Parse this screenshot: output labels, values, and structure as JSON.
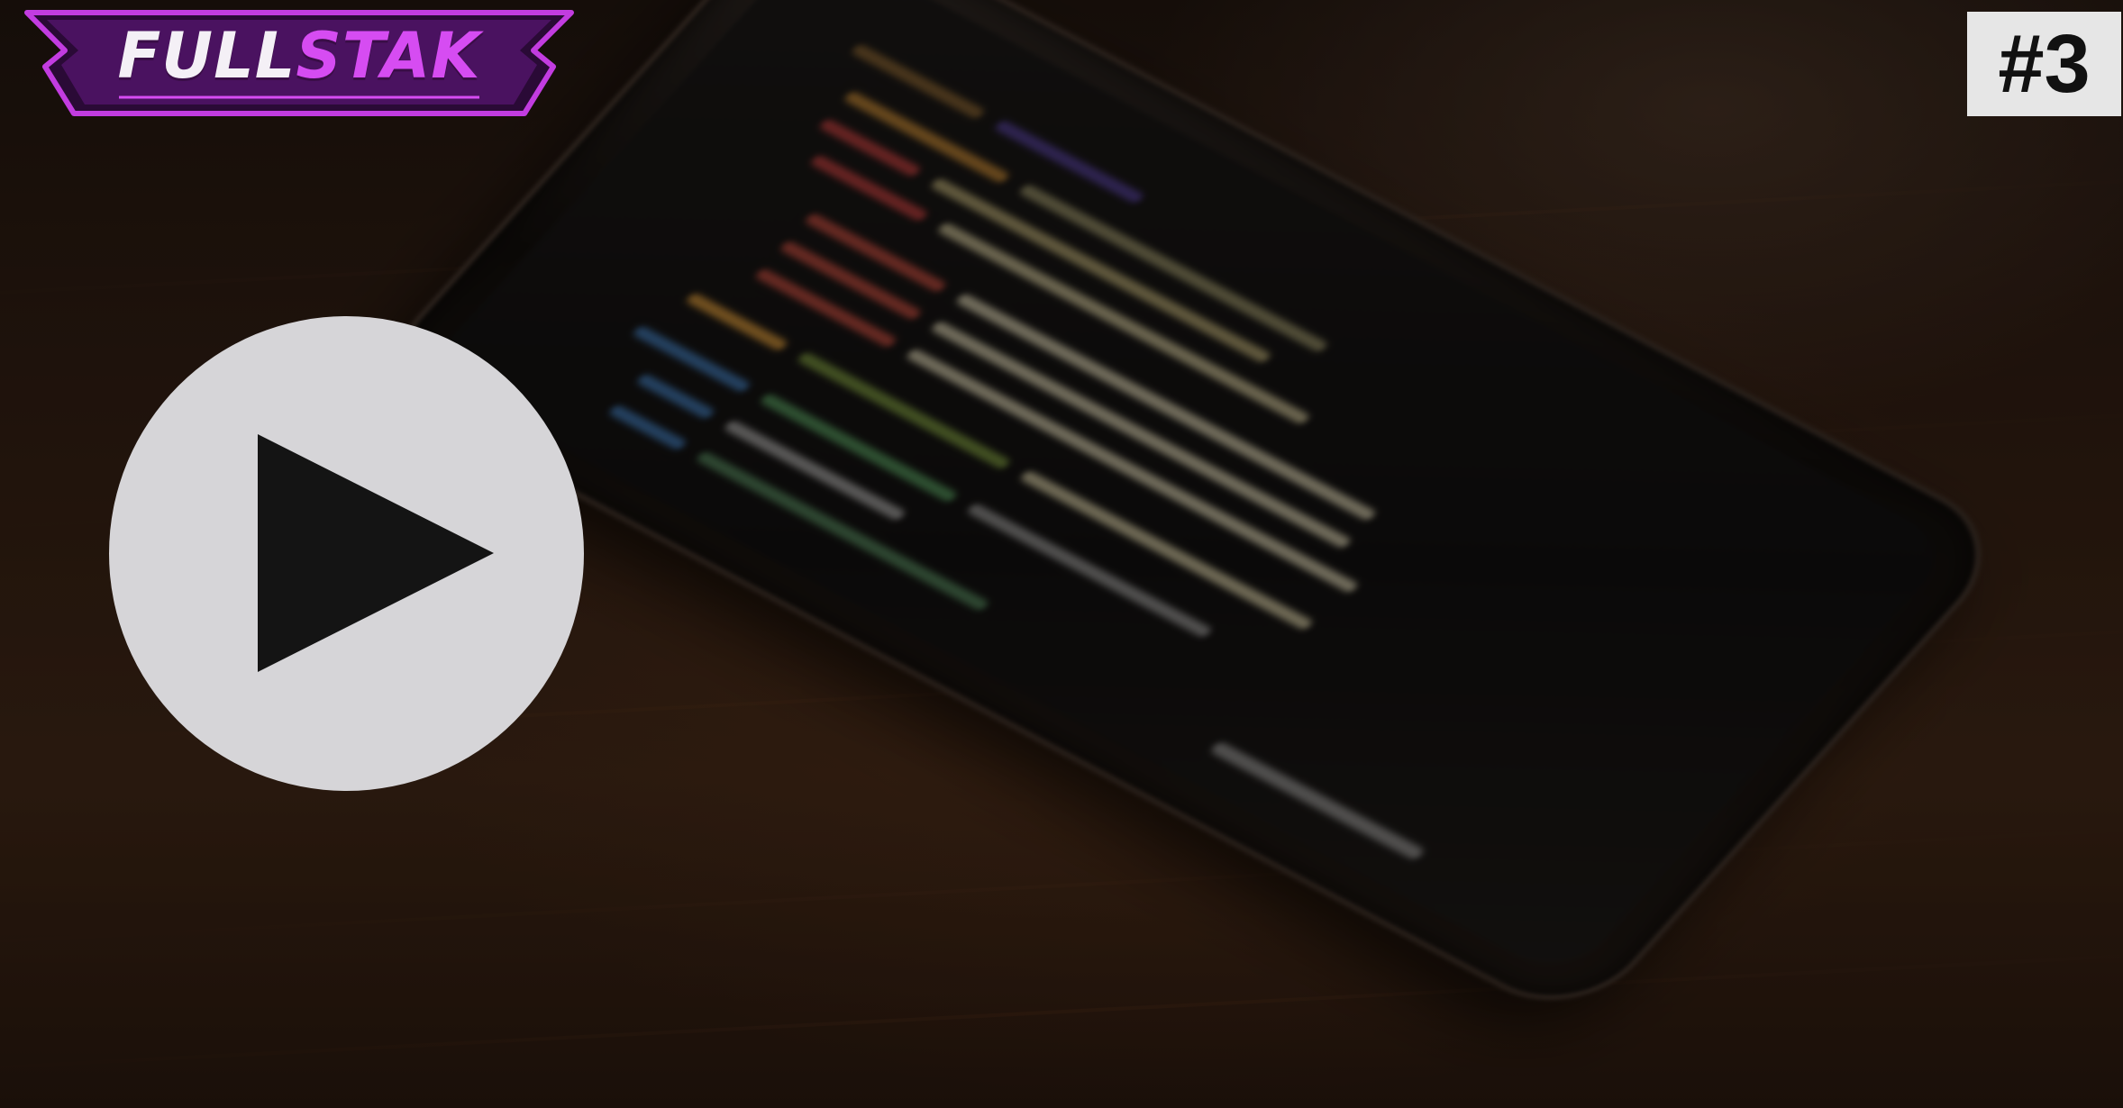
{
  "logo": {
    "part1": "FULL",
    "part2": "STAK"
  },
  "episode_badge": "#3",
  "play_button": {
    "icon": "play-icon"
  },
  "background": {
    "description_icon": "smartphone-code-icon"
  },
  "colors": {
    "logo_purple": "#d64cf2",
    "logo_dark": "#3a0d47",
    "play_circle": "#d6d5d8",
    "badge_bg": "#e6e6e6"
  }
}
